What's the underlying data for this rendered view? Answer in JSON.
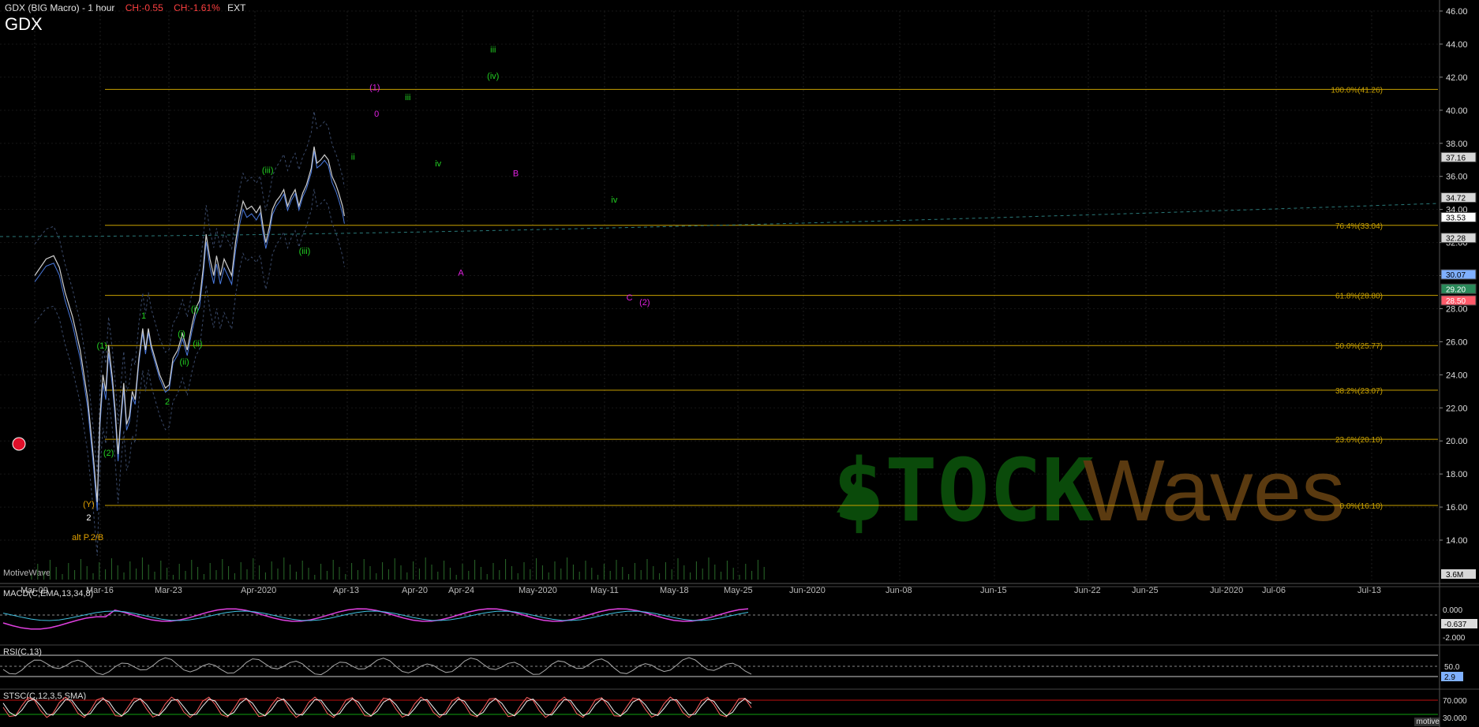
{
  "header": {
    "title": "GDX (BIG Macro) - 1 hour",
    "change_abs": "CH:-0.55",
    "change_pct": "CH:-1.61%",
    "session": "EXT",
    "symbol": "GDX"
  },
  "watermark": {
    "left": "$TOCK",
    "right": "Waves",
    "tm": "™"
  },
  "footer": {
    "brand": "MotiveWave",
    "site": "motivewave.com"
  },
  "colors": {
    "background": "#000000",
    "fib": "#c8a000",
    "price_line": "#cfcfcf",
    "wave_green": "#22d022",
    "wave_magenta": "#e020e0",
    "wave_orange": "#e0a000",
    "watermark_green": "#0a4a0a",
    "watermark_brown": "#5a3a10",
    "up_marker": "#9be89b",
    "down_marker": "#e87070"
  },
  "chart_data": [
    {
      "type": "line",
      "title": "GDX (BIG Macro) - 1 hour",
      "x_ticks": [
        "Mar-09",
        "Mar-16",
        "Mar-23",
        "Apr-2020",
        "Apr-13",
        "Apr-20",
        "Apr-24",
        "May-2020",
        "May-11",
        "May-18",
        "May-25",
        "Jun-2020",
        "Jun-08",
        "Jun-15",
        "Jun-22",
        "Jun-25",
        "Jul-2020",
        "Jul-06",
        "Jul-13"
      ],
      "y_ticks": [
        14,
        16,
        18,
        20,
        22,
        24,
        26,
        28,
        30,
        32,
        34,
        36,
        38,
        40,
        42,
        44,
        46
      ],
      "ylim": [
        12.8,
        47.2
      ],
      "y_tick_labels": [
        "14.00",
        "16.00",
        "18.00",
        "20.00",
        "22.00",
        "24.00",
        "26.00",
        "28.00",
        "30.00",
        "32.00",
        "34.00",
        "36.00",
        "38.00",
        "40.00",
        "42.00",
        "44.00",
        "46.00"
      ],
      "price_path": [
        [
          0,
          30.0
        ],
        [
          0.3,
          30.5
        ],
        [
          0.6,
          31.0
        ],
        [
          1.0,
          31.2
        ],
        [
          1.3,
          30.5
        ],
        [
          1.6,
          29.0
        ],
        [
          2.0,
          27.5
        ],
        [
          2.4,
          25.5
        ],
        [
          2.8,
          22.5
        ],
        [
          3.1,
          19.0
        ],
        [
          3.3,
          16.3
        ],
        [
          3.45,
          21.5
        ],
        [
          3.6,
          24.0
        ],
        [
          3.75,
          23.0
        ],
        [
          3.9,
          25.8
        ],
        [
          4.1,
          23.8
        ],
        [
          4.25,
          21.8
        ],
        [
          4.4,
          19.2
        ],
        [
          4.55,
          21.5
        ],
        [
          4.7,
          23.5
        ],
        [
          4.85,
          21.0
        ],
        [
          5.0,
          21.5
        ],
        [
          5.15,
          23.0
        ],
        [
          5.3,
          22.5
        ],
        [
          5.5,
          25.0
        ],
        [
          5.7,
          26.8
        ],
        [
          5.85,
          25.5
        ],
        [
          6.0,
          26.8
        ],
        [
          6.15,
          25.8
        ],
        [
          6.35,
          25.0
        ],
        [
          6.6,
          24.0
        ],
        [
          6.9,
          23.2
        ],
        [
          7.1,
          23.4
        ],
        [
          7.3,
          25.0
        ],
        [
          7.55,
          25.5
        ],
        [
          7.8,
          26.5
        ],
        [
          8.05,
          25.5
        ],
        [
          8.3,
          27.0
        ],
        [
          8.5,
          28.0
        ],
        [
          8.7,
          28.5
        ],
        [
          8.9,
          30.5
        ],
        [
          9.05,
          32.5
        ],
        [
          9.25,
          31.0
        ],
        [
          9.45,
          30.0
        ],
        [
          9.6,
          31.2
        ],
        [
          9.8,
          30.0
        ],
        [
          10.0,
          31.0
        ],
        [
          10.2,
          30.5
        ],
        [
          10.4,
          30.0
        ],
        [
          10.6,
          32.0
        ],
        [
          10.8,
          33.5
        ],
        [
          11.0,
          34.5
        ],
        [
          11.2,
          34.0
        ],
        [
          11.45,
          34.2
        ],
        [
          11.7,
          33.8
        ],
        [
          11.9,
          34.2
        ],
        [
          12.05,
          33.0
        ],
        [
          12.2,
          32.0
        ],
        [
          12.4,
          33.0
        ],
        [
          12.55,
          34.0
        ],
        [
          12.75,
          34.5
        ],
        [
          12.95,
          34.8
        ],
        [
          13.15,
          35.2
        ],
        [
          13.35,
          34.2
        ],
        [
          13.55,
          34.8
        ],
        [
          13.75,
          35.2
        ],
        [
          13.95,
          34.2
        ],
        [
          14.15,
          35.0
        ],
        [
          14.35,
          35.5
        ],
        [
          14.6,
          36.5
        ],
        [
          14.75,
          37.8
        ],
        [
          14.9,
          36.8
        ],
        [
          15.1,
          37.0
        ],
        [
          15.3,
          37.3
        ],
        [
          15.5,
          37.0
        ],
        [
          15.7,
          36.0
        ],
        [
          15.9,
          35.5
        ],
        [
          16.05,
          35.0
        ],
        [
          16.25,
          34.2
        ],
        [
          16.35,
          33.6
        ]
      ],
      "fib_levels": [
        {
          "label": "100.0%(41.26)",
          "value": 41.26
        },
        {
          "label": "76.4%(33.04)",
          "value": 33.04
        },
        {
          "label": "61.8%(28.80)",
          "value": 28.8
        },
        {
          "label": "50.0%(25.77)",
          "value": 25.77
        },
        {
          "label": "38.2%(23.07)",
          "value": 23.07
        },
        {
          "label": "23.6%(20.10)",
          "value": 20.1
        },
        {
          "label": "0.0%(16.10)",
          "value": 16.1
        }
      ],
      "price_tags": [
        {
          "label": "37.16",
          "value": 37.16,
          "color": "#d8d8d8",
          "text": "#000"
        },
        {
          "label": "34.72",
          "value": 34.72,
          "color": "#d8d8d8",
          "text": "#000"
        },
        {
          "label": "33.53",
          "value": 33.53,
          "color": "#ffffff",
          "text": "#000"
        },
        {
          "label": "32.28",
          "value": 32.28,
          "color": "#d8d8d8",
          "text": "#000"
        },
        {
          "label": "30.07",
          "value": 30.07,
          "color": "#7fb0ff",
          "text": "#000"
        },
        {
          "label": "29.20",
          "value": 29.2,
          "color": "#2a8a5a",
          "text": "#fff"
        },
        {
          "label": "28.50",
          "value": 28.5,
          "color": "#ff5a6a",
          "text": "#fff"
        }
      ],
      "volume_tag": "3.6M",
      "wave_labels": [
        {
          "text": "(1)",
          "x": 3.55,
          "y": 25.6,
          "color": "#22d022"
        },
        {
          "text": "(2)",
          "x": 3.9,
          "y": 19.1,
          "color": "#22d022"
        },
        {
          "text": "1",
          "x": 5.75,
          "y": 27.4,
          "color": "#22d022"
        },
        {
          "text": "2",
          "x": 7.0,
          "y": 22.2,
          "color": "#22d022"
        },
        {
          "text": "(i)",
          "x": 7.75,
          "y": 26.3,
          "color": "#22d022"
        },
        {
          "text": "(ii)",
          "x": 7.9,
          "y": 24.6,
          "color": "#22d022"
        },
        {
          "text": "(i)",
          "x": 8.45,
          "y": 27.8,
          "color": "#22d022"
        },
        {
          "text": "(ii)",
          "x": 8.6,
          "y": 25.7,
          "color": "#22d022"
        },
        {
          "text": "(iii)",
          "x": 12.3,
          "y": 36.2,
          "color": "#22d022"
        },
        {
          "text": "(iii)",
          "x": 14.25,
          "y": 31.3,
          "color": "#22d022"
        },
        {
          "text": "ii",
          "x": 16.8,
          "y": 37.0,
          "color": "#22d022"
        },
        {
          "text": "iii",
          "x": 19.7,
          "y": 40.6,
          "color": "#22d022"
        },
        {
          "text": "iv",
          "x": 21.3,
          "y": 36.6,
          "color": "#22d022"
        },
        {
          "text": "(iv)",
          "x": 24.2,
          "y": 41.9,
          "color": "#22d022"
        },
        {
          "text": "iii",
          "x": 24.2,
          "y": 43.5,
          "color": "#22d022"
        },
        {
          "text": "iv",
          "x": 30.6,
          "y": 34.4,
          "color": "#22d022"
        },
        {
          "text": "(1)",
          "x": 17.95,
          "y": 41.2,
          "color": "#e020e0"
        },
        {
          "text": "0",
          "x": 18.05,
          "y": 39.6,
          "color": "#e020e0"
        },
        {
          "text": "A",
          "x": 22.5,
          "y": 30.0,
          "color": "#e020e0"
        },
        {
          "text": "B",
          "x": 25.4,
          "y": 36.0,
          "color": "#e020e0"
        },
        {
          "text": "C",
          "x": 31.4,
          "y": 28.5,
          "color": "#e020e0"
        },
        {
          "text": "(2)",
          "x": 32.2,
          "y": 28.2,
          "color": "#e020e0"
        },
        {
          "text": "(Y)",
          "x": 2.85,
          "y": 16.0,
          "color": "#e0a000"
        },
        {
          "text": "2",
          "x": 2.85,
          "y": 15.2,
          "color": "#ffffff"
        },
        {
          "text": "alt P.2/B",
          "x": 2.8,
          "y": 14.0,
          "color": "#e0a000"
        }
      ]
    },
    {
      "type": "line",
      "title": "MACD(C,EMA,13,34,8)",
      "ylim": [
        -2.0,
        0.0
      ],
      "y_tick_labels": [
        "0.000",
        "-0.637",
        "-2.000"
      ],
      "last_value": -0.637
    },
    {
      "type": "line",
      "title": "RSI(C,13)",
      "y_tick_labels": [
        "50.0"
      ],
      "last_value": 29.0,
      "last_label": "2.9"
    },
    {
      "type": "line",
      "title": "STSC(C,12,3,5,SMA)",
      "y_tick_labels": [
        "70.000",
        "30.000"
      ],
      "overbought": 70,
      "oversold": 30
    }
  ]
}
